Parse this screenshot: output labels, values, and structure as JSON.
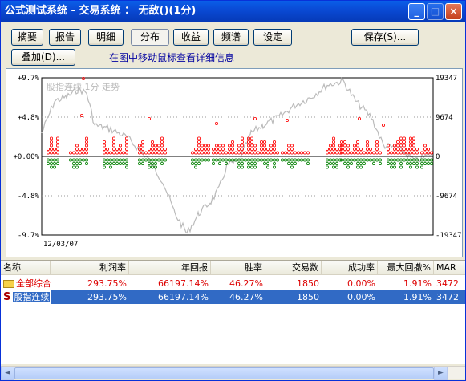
{
  "window": {
    "title": "公式测试系统 - 交易系统 ： 无敌()(1分)",
    "minimize": "_",
    "maximize": "□",
    "close": "×"
  },
  "toolbar": {
    "tabs": [
      {
        "label": "摘要"
      },
      {
        "label": "报告"
      },
      {
        "label": "明细"
      },
      {
        "label": "分布"
      },
      {
        "label": "收益"
      },
      {
        "label": "频谱"
      },
      {
        "label": "设定"
      }
    ],
    "active_tab": "分布",
    "save_label": "保存(S)...",
    "overlay_label": "叠加(D)...",
    "hint": "在图中移动鼠标查看详细信息"
  },
  "chart": {
    "left_ticks": [
      "+9.7%",
      "+4.8%",
      "+0.00%",
      "-4.8%",
      "-9.7%"
    ],
    "right_ticks": [
      "19347",
      "9674",
      "0",
      "-9674",
      "-19347"
    ],
    "date_label": "12/03/07",
    "watermark": "股指连续 1分 走势",
    "colors": {
      "profit": "#ff0000",
      "loss": "#008000",
      "background_line": "#bbbbbb",
      "zero_line": "#000000"
    }
  },
  "table": {
    "columns": [
      "名称",
      "利润率",
      "年回报",
      "胜率",
      "交易数",
      "成功率",
      "最大回撤%",
      "MAR"
    ],
    "rows": [
      {
        "name": "全部综合",
        "profit_rate": "293.75%",
        "annual_return": "66197.14%",
        "win_rate": "46.27%",
        "trades": "1850",
        "success_rate": "0.00%",
        "max_drawdown": "1.91%",
        "mar": "3472",
        "icon": "folder-icon"
      },
      {
        "name": "股指连续",
        "profit_rate": "293.75%",
        "annual_return": "66197.14%",
        "win_rate": "46.27%",
        "trades": "1850",
        "success_rate": "0.00%",
        "max_drawdown": "1.91%",
        "mar": "3472",
        "icon": "s-symbol-icon",
        "selected": true
      }
    ]
  },
  "scrollbar": {
    "left_arrow": "◄",
    "right_arrow": "►"
  }
}
